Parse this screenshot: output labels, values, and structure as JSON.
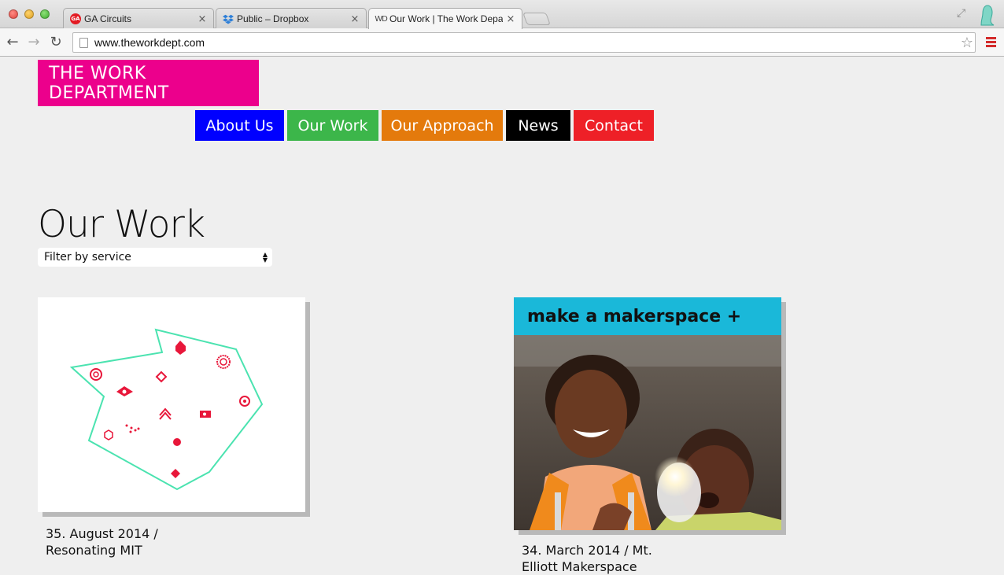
{
  "browser": {
    "tabs": [
      {
        "title": "GA Circuits",
        "icon": "ga-icon",
        "active": false
      },
      {
        "title": "Public – Dropbox",
        "icon": "dropbox-icon",
        "active": false
      },
      {
        "title": "Our Work | The Work Depa",
        "icon": "wd-icon",
        "active": true
      }
    ],
    "favicon_ga_text": "GA",
    "favicon_wd_text": "WD",
    "url": "www.theworkdept.com"
  },
  "site": {
    "logo": "THE WORK DEPARTMENT",
    "brand_color": "#ec008c",
    "nav": [
      {
        "label": "About Us",
        "color": "#0000ff"
      },
      {
        "label": "Our Work",
        "color": "#3cb64a"
      },
      {
        "label": "Our Approach",
        "color": "#e47a0c"
      },
      {
        "label": "News",
        "color": "#000000"
      },
      {
        "label": "Contact",
        "color": "#ee2027"
      }
    ]
  },
  "main": {
    "title": "Our Work",
    "filter": {
      "selected": "Filter by service"
    },
    "projects": [
      {
        "caption": "35. August 2014 / Resonating MIT"
      },
      {
        "caption": "34. March 2014 / Mt. Elliott Makerspace",
        "banner_text": "make a makerspace +"
      }
    ]
  }
}
